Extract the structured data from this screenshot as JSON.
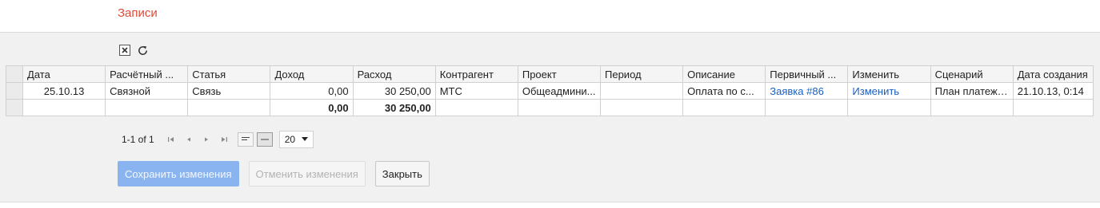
{
  "page": {
    "title": "Записи"
  },
  "toolbar": {
    "icons": [
      "excel-export-icon",
      "refresh-icon"
    ]
  },
  "grid": {
    "columns": [
      "Дата",
      "Расчётный ...",
      "Статья",
      "Доход",
      "Расход",
      "Контрагент",
      "Проект",
      "Период",
      "Описание",
      "Первичный ...",
      "Изменить",
      "Сценарий",
      "Дата создания"
    ],
    "rows": [
      {
        "date": "25.10.13",
        "account": "Связной",
        "article": "Связь",
        "income": "0,00",
        "expense": "30 250,00",
        "counterparty": "МТС",
        "project": "Общеадмини...",
        "period": "",
        "description": "Оплата по с...",
        "primary": "Заявка #86",
        "edit": "Изменить",
        "scenario": "План платежей",
        "created": "21.10.13, 0:14"
      }
    ],
    "totals": {
      "income": "0,00",
      "expense": "30 250,00"
    }
  },
  "pager": {
    "range": "1-1 of 1",
    "page_size": "20"
  },
  "buttons": {
    "save": "Сохранить изменения",
    "cancel": "Отменить изменения",
    "close": "Закрыть"
  },
  "colors": {
    "title": "#dd4b39",
    "link": "#1a5fc0",
    "primary_button": "#8ab4f0"
  }
}
